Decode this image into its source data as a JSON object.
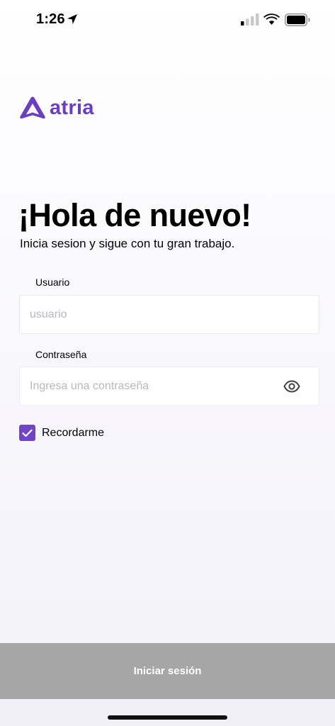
{
  "status_bar": {
    "time": "1:26",
    "icons": [
      "location-arrow-icon",
      "cellular-signal-icon",
      "wifi-icon",
      "battery-icon"
    ]
  },
  "brand": {
    "name": "atria",
    "color": "#6a3fbf"
  },
  "login": {
    "title": "¡Hola de nuevo!",
    "subtitle": "Inicia sesion y sigue con tu gran trabajo.",
    "username": {
      "label": "Usuario",
      "placeholder": "usuario",
      "value": ""
    },
    "password": {
      "label": "Contraseña",
      "placeholder": "Ingresa una contraseña",
      "value": "",
      "toggle_icon": "eye-icon"
    },
    "remember": {
      "label": "Recordarme",
      "checked": true,
      "color": "#6f45c6"
    },
    "submit_label": "Iniciar sesión",
    "submit_color": "#a6a6a6"
  }
}
